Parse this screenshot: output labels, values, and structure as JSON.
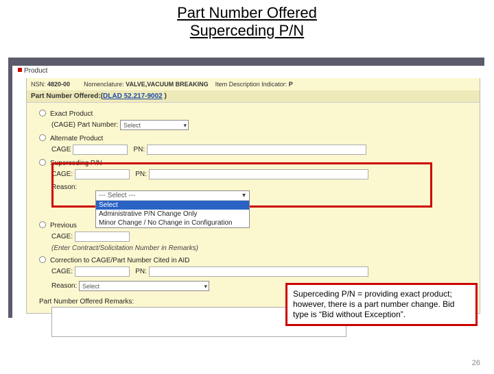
{
  "title": {
    "line1": "Part Number Offered",
    "line2": "Superceding P/N"
  },
  "header": {
    "product_label": "Product",
    "nsn_label": "NSN:",
    "nsn_value": "4820-00",
    "nomen_label": "Nomenclature:",
    "nomen_value": "VALVE,VACUUM BREAKING",
    "idi_label": "Item Description Indicator:",
    "idi_value": "P",
    "pno_label": "Part Number Offered:(",
    "pno_link": "DLAD 52.217-9002",
    "pno_close": " )"
  },
  "form": {
    "exact": {
      "label": "Exact Product",
      "sub_label": "(CAGE) Part Number:",
      "select": "Select"
    },
    "alt": {
      "label": "Alternate Product",
      "cage_label": "CAGE",
      "pn_label": "PN:"
    },
    "super": {
      "label": "Superceding P/N",
      "cage_label": "CAGE:",
      "pn_label": "PN:",
      "reason_label": "Reason:"
    },
    "reason_dd": {
      "header": "--- Select ---",
      "opt_select": "Select",
      "opt_admin": "Administrative P/N Change Only",
      "opt_minor": "Minor Change / No Change in Configuration"
    },
    "prev": {
      "label": "Previous",
      "cage_label": "CAGE:",
      "note": "(Enter Contract/Solicitation Number in Remarks)"
    },
    "corr": {
      "label": "Correction to CAGE/Part Number Cited in AID",
      "cage_label": "CAGE:",
      "pn_label": "PN:",
      "reason_label": "Reason:",
      "select": "Select"
    },
    "remarks": {
      "label": "Part Number Offered Remarks:"
    }
  },
  "note_box": "Superceding P/N = providing exact product; however, there is a part number change. Bid type is “Bid without Exception”.",
  "page_number": "26"
}
